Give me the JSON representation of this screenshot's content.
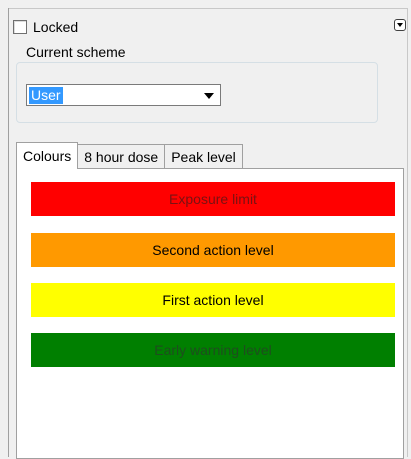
{
  "locked": {
    "label": "Locked",
    "checked": false
  },
  "scheme": {
    "group_label": "Current scheme",
    "selected": "User"
  },
  "tabs": [
    {
      "label": "Colours",
      "active": true
    },
    {
      "label": "8 hour dose",
      "active": false
    },
    {
      "label": "Peak level",
      "active": false
    }
  ],
  "levels": [
    {
      "label": "Exposure limit",
      "color": "#ff0000",
      "text_color": "#7a1212"
    },
    {
      "label": "Second action level",
      "color": "#ff9900",
      "text_color": "#000000"
    },
    {
      "label": "First action level",
      "color": "#ffff00",
      "text_color": "#000000"
    },
    {
      "label": "Early warning level",
      "color": "#007f00",
      "text_color": "#1e4d1e"
    }
  ],
  "icons": {
    "collapse": "chevron-down-icon",
    "dropdown": "dropdown-arrow-icon"
  }
}
